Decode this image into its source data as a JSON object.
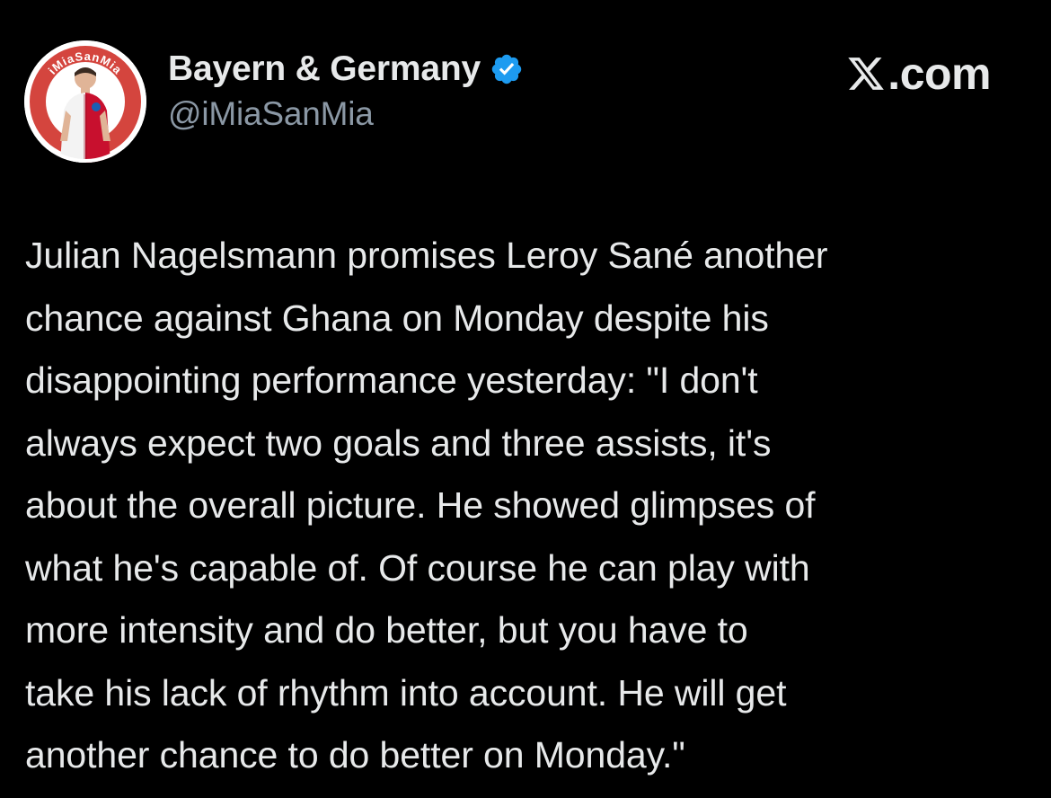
{
  "colors": {
    "background": "#000000",
    "text_primary": "#e7e9ea",
    "text_secondary": "#8b98a5",
    "verified_badge": "#1d9bf0",
    "avatar_ring": "#d4453e"
  },
  "post": {
    "author": {
      "display_name": "Bayern & Germany",
      "handle": "@iMiaSanMia",
      "verified": true,
      "avatar_icon": "player-avatar-icon",
      "avatar_ring_text": "iMiaSanMia"
    },
    "site": {
      "logo_icon": "x-logo-icon",
      "label": ".com"
    },
    "text_lines": [
      "Julian Nagelsmann promises Leroy Sané another",
      "chance against Ghana on Monday despite his",
      "disappointing performance yesterday: \"I don't",
      "always expect two goals and three assists, it's",
      "about the overall picture. He showed glimpses of",
      "what he's capable of. Of course he can play with",
      "more intensity and do better, but you have to",
      "take his lack of rhythm into account. He will get",
      "another chance to do better on Monday.\""
    ]
  }
}
